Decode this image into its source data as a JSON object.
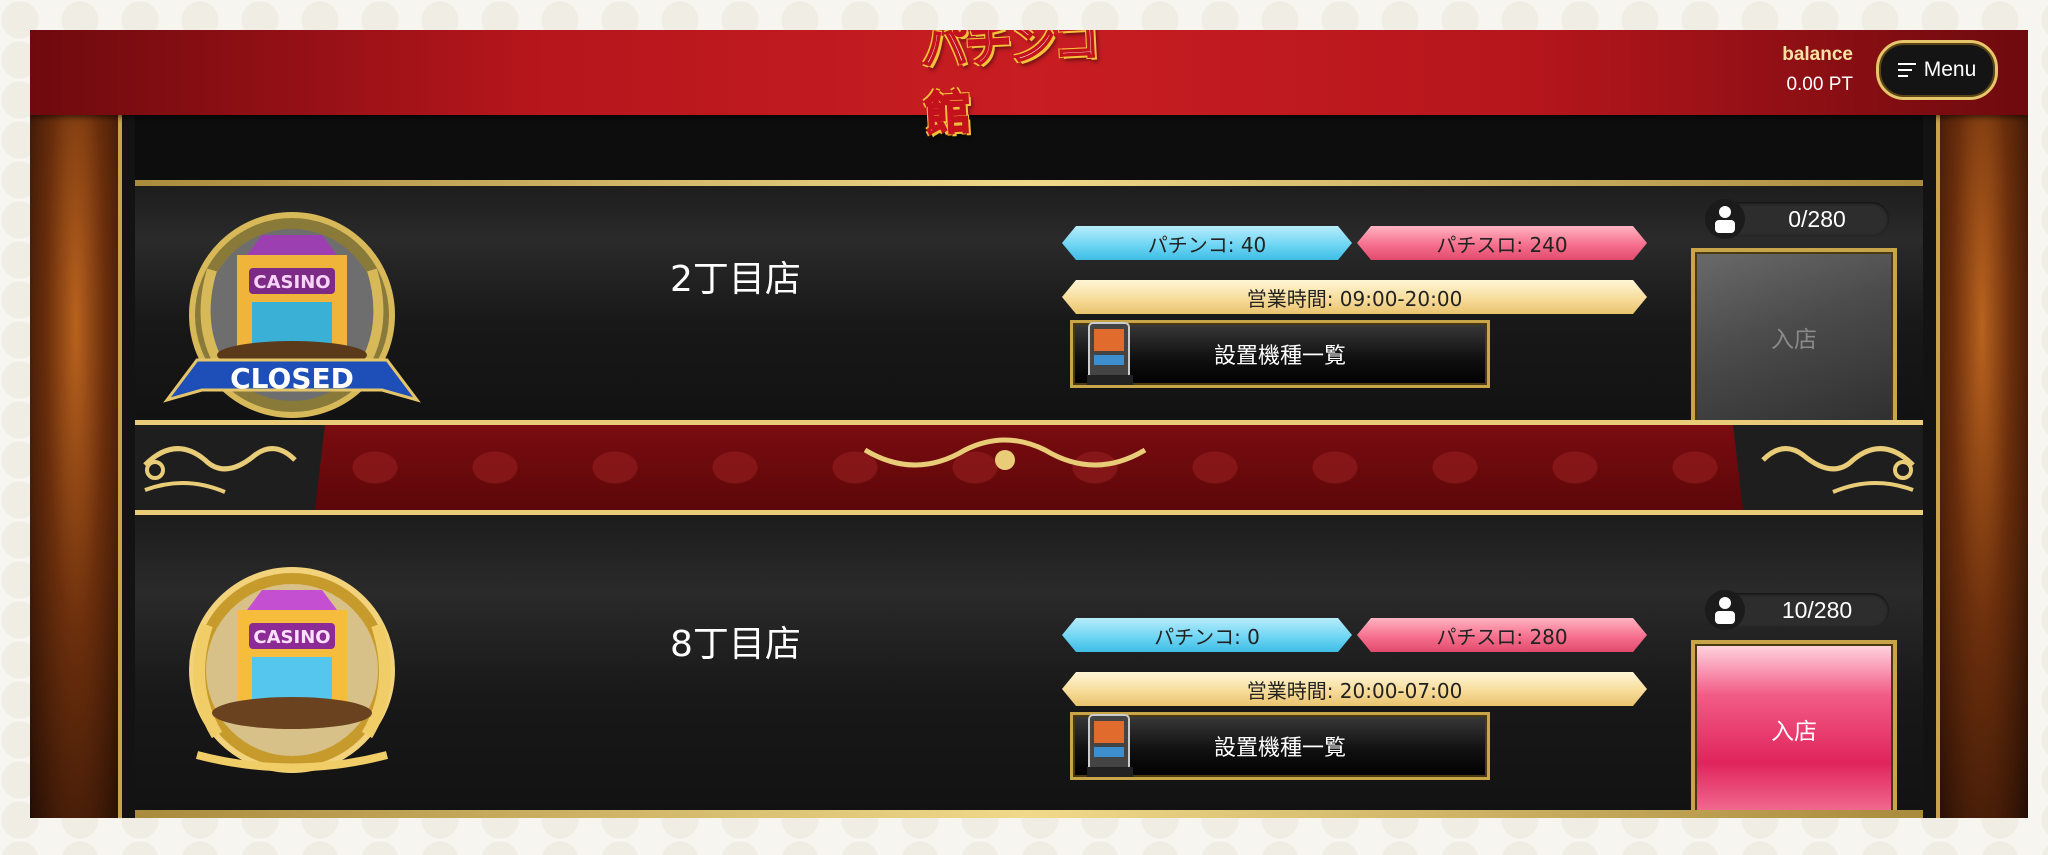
{
  "header": {
    "logo_text": "パチンコ館",
    "balance_label": "balance",
    "balance_value": "0.00 PT",
    "menu_label": "Menu"
  },
  "shops": [
    {
      "name": "2丁目店",
      "status": "CLOSED",
      "badge_text": "CASINO",
      "pachinko": "パチンコ: 40",
      "pachislo": "パチスロ: 240",
      "hours": "営業時間: 09:00-20:00",
      "machines_button": "設置機種一覧",
      "occupancy": "0/280",
      "enter_label": "入店",
      "enter_enabled": false
    },
    {
      "name": "8丁目店",
      "status": "",
      "badge_text": "CASINO",
      "pachinko": "パチンコ: 0",
      "pachislo": "パチスロ: 280",
      "hours": "営業時間: 20:00-07:00",
      "machines_button": "設置機種一覧",
      "occupancy": "10/280",
      "enter_label": "入店",
      "enter_enabled": true
    }
  ],
  "colors": {
    "header_red": "#c81d22",
    "gold": "#e9cc78",
    "pachinko_blue": "#6fd6f4",
    "pachislo_pink": "#f5708d",
    "enter_active": "#e0245c"
  }
}
